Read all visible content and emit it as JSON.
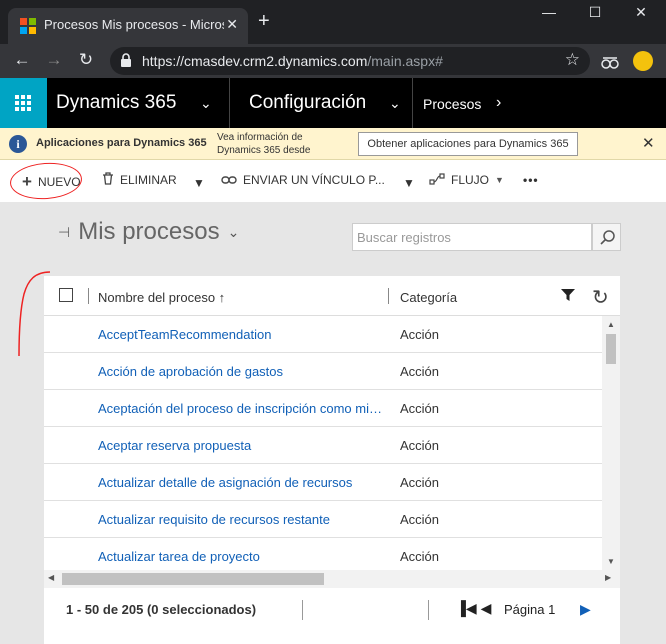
{
  "browser": {
    "tab_title": "Procesos Mis procesos - Microso",
    "close_glyph": "✕",
    "new_tab_glyph": "+",
    "url_host": "https://cmasdev.crm2.dynamics.com",
    "url_path": "/main.aspx#",
    "window_controls": [
      "—",
      "☐",
      "✕"
    ]
  },
  "nav": {
    "app_name": "Dynamics 365",
    "area": "Configuración",
    "breadcrumb": "Procesos",
    "colors": {
      "waffle_bg": "#00a4c4",
      "bar_bg": "#000000"
    }
  },
  "infobar": {
    "title": "Aplicaciones para Dynamics 365",
    "text": "Vea información de Dynamics 365 desde",
    "button": "Obtener aplicaciones para Dynamics 365",
    "info_glyph": "i",
    "close_glyph": "✕"
  },
  "toolbar": {
    "new": "NUEVO",
    "delete": "ELIMINAR",
    "send_link": "ENVIAR UN VÍNCULO P...",
    "flow": "FLUJO",
    "more": "•••"
  },
  "view": {
    "title": "Mis procesos",
    "search_placeholder": "Buscar registros"
  },
  "grid": {
    "columns": [
      "Nombre del proceso ↑",
      "Categoría"
    ],
    "rows": [
      {
        "name": "AcceptTeamRecommendation",
        "category": "Acción"
      },
      {
        "name": "Acción de aprobación de gastos",
        "category": "Acción"
      },
      {
        "name": "Aceptación del proceso de inscripción como miembro",
        "category": "Acción"
      },
      {
        "name": "Aceptar reserva propuesta",
        "category": "Acción"
      },
      {
        "name": "Actualizar detalle de asignación de recursos",
        "category": "Acción"
      },
      {
        "name": "Actualizar requisito de recursos restante",
        "category": "Acción"
      },
      {
        "name": "Actualizar tarea de proyecto",
        "category": "Acción"
      }
    ]
  },
  "footer": {
    "range": "1 - 50",
    "total": "de 205 (0 seleccionados)",
    "page_label": "Página 1"
  }
}
